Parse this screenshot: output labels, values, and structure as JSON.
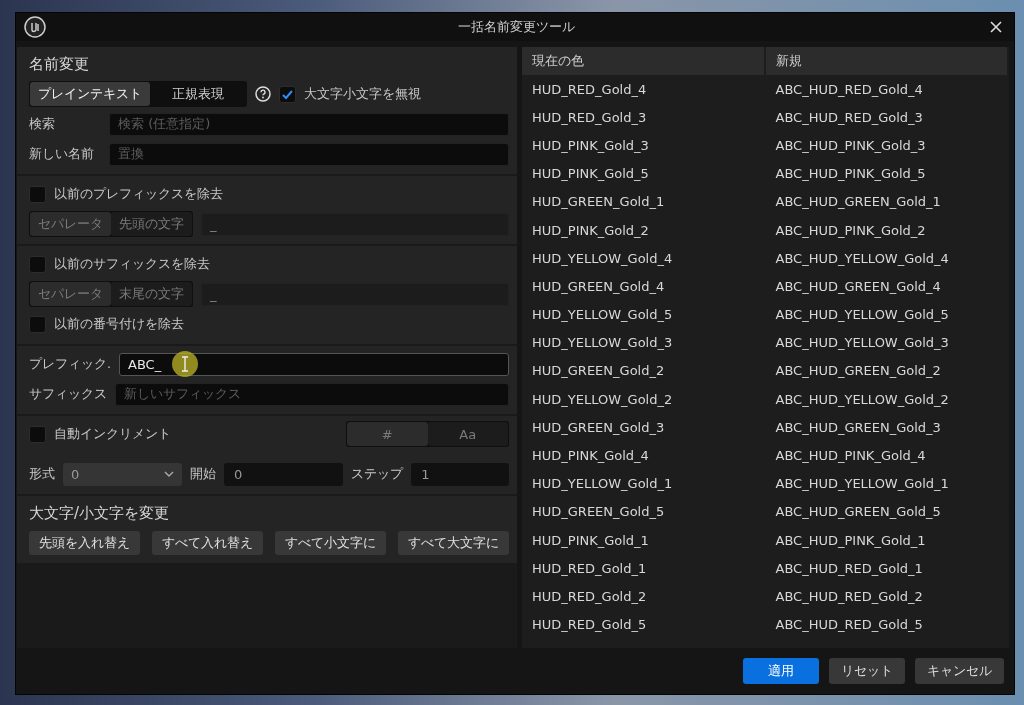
{
  "window": {
    "title": "一括名前変更ツール"
  },
  "rename": {
    "title": "名前変更",
    "modes": [
      {
        "label": "プレインテキスト",
        "selected": true
      },
      {
        "label": "正規表現",
        "selected": false
      }
    ],
    "ignore_case": {
      "label": "大文字小文字を無視",
      "checked": true
    },
    "fields": [
      {
        "label": "検索",
        "placeholder": "検索 (任意指定)"
      },
      {
        "label": "新しい名前",
        "placeholder": "置換"
      }
    ]
  },
  "remove_prefix": {
    "label": "以前のプレフィックスを除去",
    "checked": false,
    "modes": [
      {
        "label": "セパレータ",
        "selected": true
      },
      {
        "label": "先頭の文字",
        "selected": false
      }
    ],
    "value": "_"
  },
  "remove_suffix": {
    "label": "以前のサフィックスを除去",
    "checked": false,
    "modes": [
      {
        "label": "セパレータ",
        "selected": true
      },
      {
        "label": "末尾の文字",
        "selected": false
      }
    ],
    "value": "_"
  },
  "remove_numbering": {
    "label": "以前の番号付けを除去",
    "checked": false
  },
  "affixes": [
    {
      "label": "プレフィック.",
      "value": "ABC_",
      "focused": true
    },
    {
      "label": "サフィックス",
      "placeholder": "新しいサフィックス",
      "focused": false
    }
  ],
  "auto_increment": {
    "label": "自動インクリメント",
    "checked": false,
    "modes": [
      {
        "label": "#",
        "selected": true
      },
      {
        "label": "Aa",
        "selected": false
      }
    ],
    "format": {
      "label": "形式",
      "value": "0"
    },
    "start": {
      "label": "開始",
      "value": "0"
    },
    "step": {
      "label": "ステップ",
      "value": "1"
    }
  },
  "change_case": {
    "title": "大文字/小文字を変更",
    "buttons": [
      "先頭を入れ替え",
      "すべて入れ替え",
      "すべて小文字に",
      "すべて大文字に"
    ]
  },
  "preview": {
    "columns": [
      "現在の色",
      "新規"
    ],
    "rows": [
      [
        "HUD_RED_Gold_4",
        "ABC_HUD_RED_Gold_4"
      ],
      [
        "HUD_RED_Gold_3",
        "ABC_HUD_RED_Gold_3"
      ],
      [
        "HUD_PINK_Gold_3",
        "ABC_HUD_PINK_Gold_3"
      ],
      [
        "HUD_PINK_Gold_5",
        "ABC_HUD_PINK_Gold_5"
      ],
      [
        "HUD_GREEN_Gold_1",
        "ABC_HUD_GREEN_Gold_1"
      ],
      [
        "HUD_PINK_Gold_2",
        "ABC_HUD_PINK_Gold_2"
      ],
      [
        "HUD_YELLOW_Gold_4",
        "ABC_HUD_YELLOW_Gold_4"
      ],
      [
        "HUD_GREEN_Gold_4",
        "ABC_HUD_GREEN_Gold_4"
      ],
      [
        "HUD_YELLOW_Gold_5",
        "ABC_HUD_YELLOW_Gold_5"
      ],
      [
        "HUD_YELLOW_Gold_3",
        "ABC_HUD_YELLOW_Gold_3"
      ],
      [
        "HUD_GREEN_Gold_2",
        "ABC_HUD_GREEN_Gold_2"
      ],
      [
        "HUD_YELLOW_Gold_2",
        "ABC_HUD_YELLOW_Gold_2"
      ],
      [
        "HUD_GREEN_Gold_3",
        "ABC_HUD_GREEN_Gold_3"
      ],
      [
        "HUD_PINK_Gold_4",
        "ABC_HUD_PINK_Gold_4"
      ],
      [
        "HUD_YELLOW_Gold_1",
        "ABC_HUD_YELLOW_Gold_1"
      ],
      [
        "HUD_GREEN_Gold_5",
        "ABC_HUD_GREEN_Gold_5"
      ],
      [
        "HUD_PINK_Gold_1",
        "ABC_HUD_PINK_Gold_1"
      ],
      [
        "HUD_RED_Gold_1",
        "ABC_HUD_RED_Gold_1"
      ],
      [
        "HUD_RED_Gold_2",
        "ABC_HUD_RED_Gold_2"
      ],
      [
        "HUD_RED_Gold_5",
        "ABC_HUD_RED_Gold_5"
      ]
    ]
  },
  "footer": {
    "buttons": [
      {
        "label": "適用",
        "primary": true
      },
      {
        "label": "リセット",
        "primary": false
      },
      {
        "label": "キャンセル",
        "primary": false
      }
    ]
  }
}
